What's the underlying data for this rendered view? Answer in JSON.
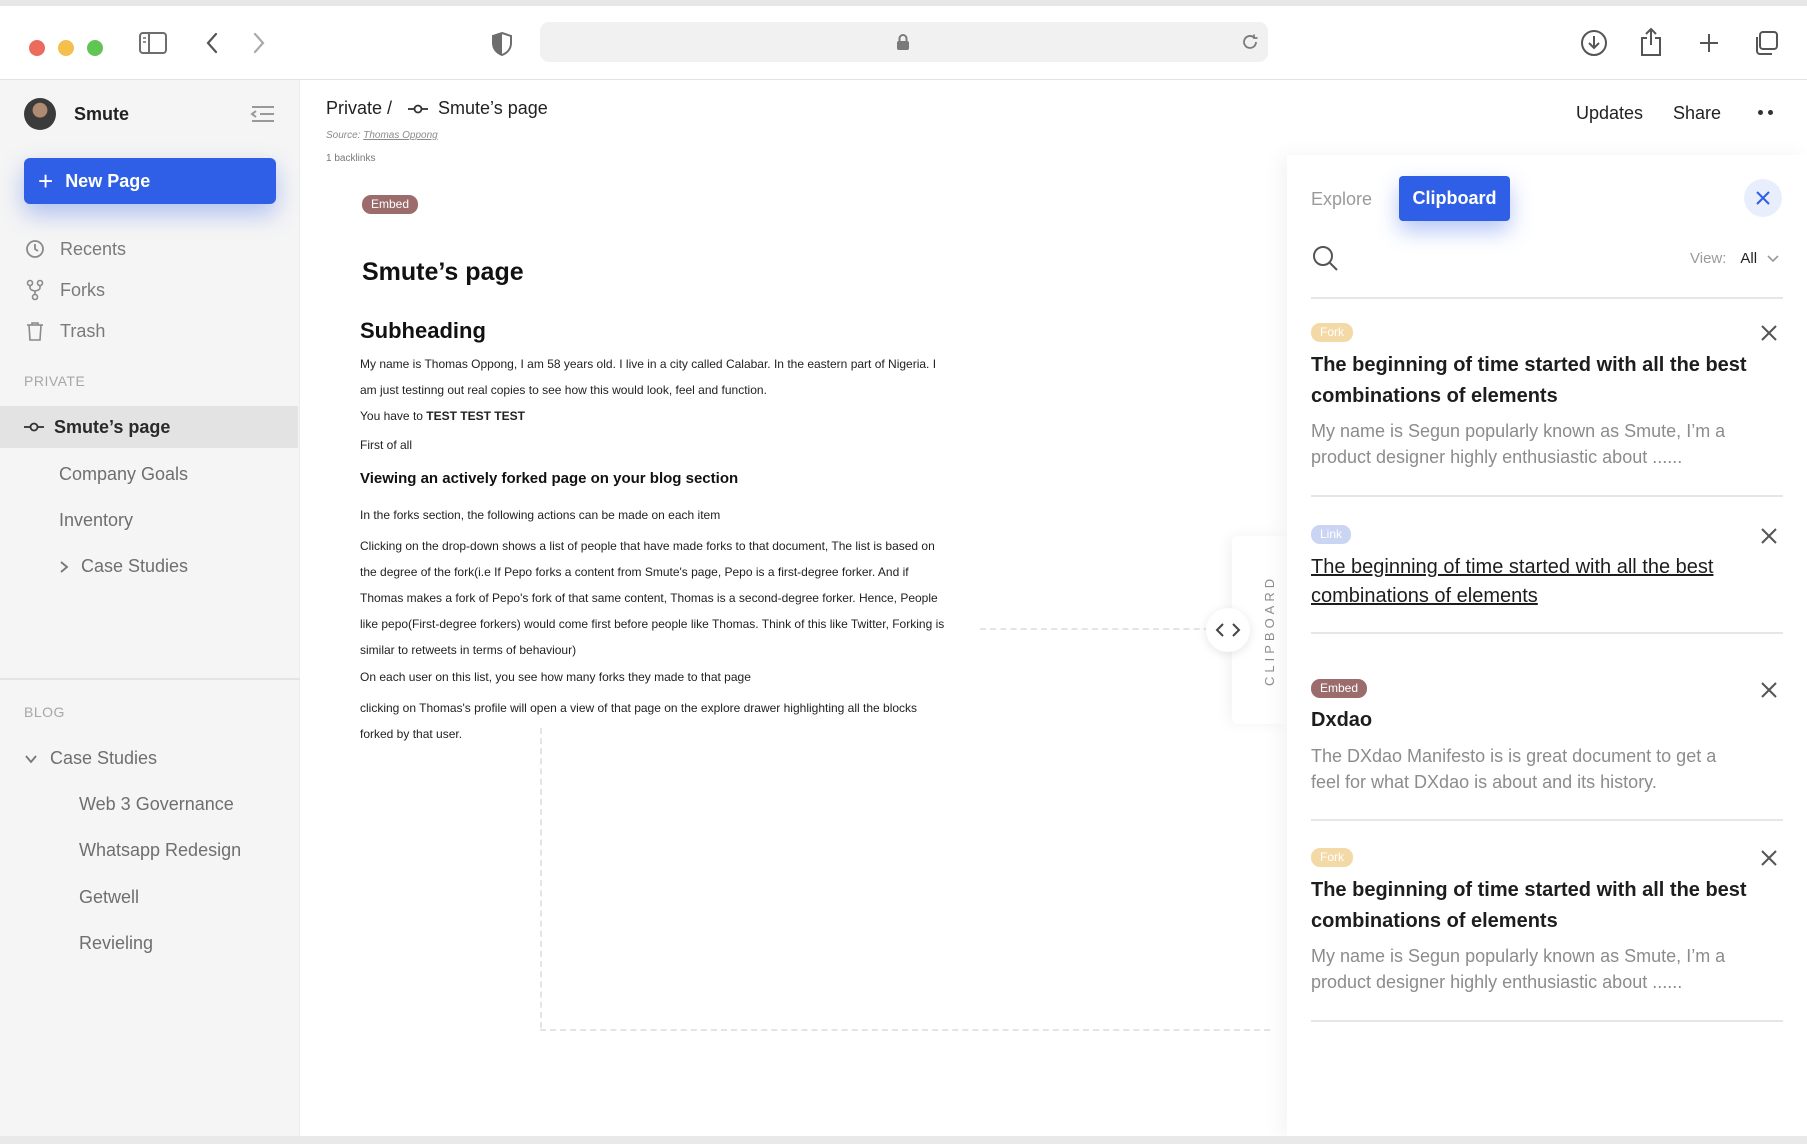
{
  "browser": {
    "sidebar_toggle_icon": "sidebar-icon",
    "back_icon": "chevron-left-icon",
    "forward_icon": "chevron-right-icon",
    "privacy_icon": "shield-icon",
    "lock_icon": "lock-icon",
    "reload_icon": "reload-icon",
    "download_icon": "download-icon",
    "share_icon": "share-icon",
    "new_tab_icon": "plus-icon",
    "tabs_icon": "tabs-overview-icon"
  },
  "sidebar": {
    "workspace_name": "Smute",
    "new_page_label": "New Page",
    "nav": [
      {
        "label": "Recents",
        "icon": "clock-icon"
      },
      {
        "label": "Forks",
        "icon": "fork-icon"
      },
      {
        "label": "Trash",
        "icon": "trash-icon"
      }
    ],
    "private_heading": "PRIVATE",
    "active_page": "Smute’s page",
    "private_children": [
      "Company Goals",
      "Inventory",
      "Case Studies"
    ],
    "blog_heading": "BLOG",
    "blog_folder": "Case Studies",
    "blog_children": [
      "Web 3 Governance",
      "Whatsapp Redesign",
      "Getwell",
      "Revieling"
    ]
  },
  "header": {
    "breadcrumb_root": "Private /",
    "breadcrumb_page": "Smute’s page",
    "source_label": "Source:",
    "source_author": "Thomas Oppong",
    "backlinks": "1 backlinks",
    "updates_label": "Updates",
    "share_label": "Share"
  },
  "document": {
    "tag": "Embed",
    "title": "Smute’s page",
    "subheading": "Subheading",
    "intro_line1": "My name is Thomas Oppong, I am 58 years old. I live in a city called Calabar. In the eastern part of Nigeria. I",
    "intro_line2": "am just testinng out real copies to see how this would look, feel and function.",
    "test_prefix": "You have to ",
    "test_bold": "TEST TEST TEST",
    "first_of_all": "First of all",
    "section_heading": "Viewing an actively forked page on your blog section",
    "forks_intro": "In the forks section, the following actions can be made on each item",
    "para_lines": [
      "Clicking on the drop-down shows a list of people that have made forks to that document, The list is based on",
      "the degree of the fork(i.e If Pepo forks a content from Smute's page, Pepo is a first-degree forker. And if",
      "Thomas makes a fork of Pepo's fork of that same content, Thomas is a second-degree forker. Hence, People",
      "like pepo(First-degree forkers) would come first before people like Thomas. Think of this like Twitter, Forking is",
      "similar to retweets in terms of behaviour)"
    ],
    "each_user": "On each user on this list, you see how many forks they made to that page",
    "clicking_lines": [
      "clicking on Thomas's profile will open a view of that page on the explore drawer highlighting all the blocks",
      "forked by that user."
    ]
  },
  "clipboard_strip": {
    "label": "CLIPBOARD",
    "toggle_icon": "code-chevrons-icon"
  },
  "panel": {
    "tab_explore": "Explore",
    "tab_clipboard": "Clipboard",
    "close_icon": "close-icon",
    "search_icon": "search-icon",
    "view_label": "View:",
    "view_value": "All",
    "cards": [
      {
        "tag": "Fork",
        "title": "The beginning of time started with all the best combinations of elements",
        "desc": "My name is Segun popularly known as Smute, I’m a product designer highly enthusiastic about ......"
      },
      {
        "tag": "Link",
        "title": "The beginning of time started with all the best combinations of elements",
        "desc": ""
      },
      {
        "tag": "Embed",
        "title": "Dxdao",
        "desc": "The DXdao Manifesto is is great document to get a feel for what DXdao is about and its history."
      },
      {
        "tag": "Fork",
        "title": "The beginning of time started with all the best combinations of elements",
        "desc": "My name is Segun popularly known as Smute, I’m a product designer highly enthusiastic about ......"
      }
    ]
  },
  "colors": {
    "accent": "#2f5fe6",
    "sidebar_bg": "#f5f5f5",
    "active_row": "#e3e3e3",
    "embed_tag": "#9c6b6b",
    "fork_tag": "#f3d9a6",
    "link_tag": "#c9d5f3"
  }
}
